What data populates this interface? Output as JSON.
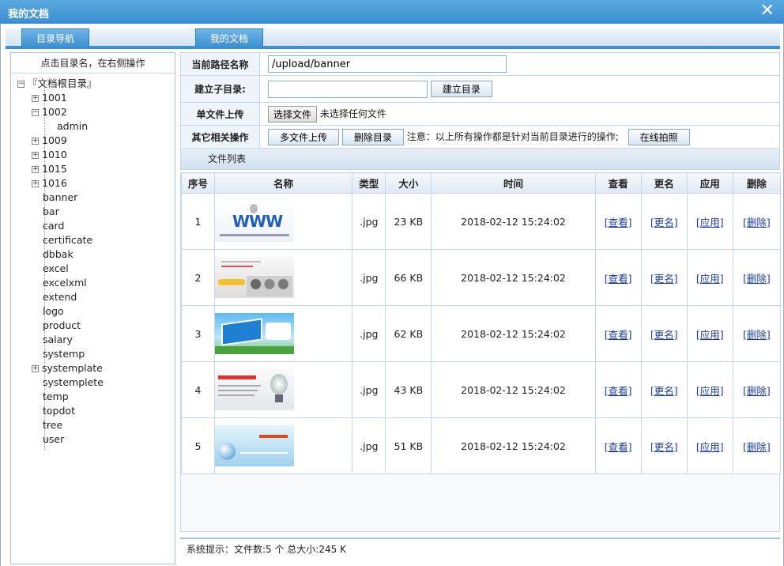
{
  "window": {
    "title": "我的文档",
    "close_glyph": "✕"
  },
  "tabs": [
    {
      "label": "目录导航"
    },
    {
      "label": "我的文档"
    }
  ],
  "left": {
    "hint": "点击目录名，在右侧操作",
    "root": "『文档根目录』",
    "nodes": [
      {
        "label": "1001",
        "expandable": true
      },
      {
        "label": "1002",
        "expanded": true
      },
      {
        "label": "admin",
        "child": true
      },
      {
        "label": "1009",
        "expandable": true
      },
      {
        "label": "1010",
        "expandable": true
      },
      {
        "label": "1015",
        "expandable": true
      },
      {
        "label": "1016",
        "expandable": true
      },
      {
        "label": "banner"
      },
      {
        "label": "bar"
      },
      {
        "label": "card"
      },
      {
        "label": "certificate"
      },
      {
        "label": "dbbak"
      },
      {
        "label": "excel"
      },
      {
        "label": "excelxml"
      },
      {
        "label": "extend"
      },
      {
        "label": "logo"
      },
      {
        "label": "product"
      },
      {
        "label": "salary"
      },
      {
        "label": "systemp"
      },
      {
        "label": "systemplate",
        "expandable": true
      },
      {
        "label": "systemplete"
      },
      {
        "label": "temp"
      },
      {
        "label": "topdot"
      },
      {
        "label": "tree"
      },
      {
        "label": "user"
      }
    ]
  },
  "ops": {
    "path_label": "当前路径名称",
    "path_value": "/upload/banner",
    "mkdir_label": "建立子目录:",
    "mkdir_placeholder": "",
    "mkdir_button": "建立目录",
    "upload_label": "单文件上传",
    "choose_file_button": "选择文件",
    "no_file_text": "未选择任何文件",
    "other_label": "其它相关操作",
    "multi_upload_button": "多文件上传",
    "delete_dir_button": "删除目录",
    "note": "注意：以上所有操作都是针对当前目录进行的操作;",
    "photo_button": "在线拍照"
  },
  "list": {
    "title": "文件列表",
    "headers": [
      "序号",
      "名称",
      "类型",
      "大小",
      "时间",
      "查看",
      "更名",
      "应用",
      "删除"
    ],
    "action_labels": {
      "view": "[查看]",
      "rename": "[更名]",
      "apply": "[应用]",
      "delete": "[删除]"
    },
    "rows": [
      {
        "no": "1",
        "type": ".jpg",
        "size": "23 KB",
        "time": "2018-02-12 15:24:02",
        "thumb": "www-banner"
      },
      {
        "no": "2",
        "type": ".jpg",
        "size": "66 KB",
        "time": "2018-02-12 15:24:02",
        "thumb": "crowd-banner"
      },
      {
        "no": "3",
        "type": ".jpg",
        "size": "62 KB",
        "time": "2018-02-12 15:24:02",
        "thumb": "sky-card-banner"
      },
      {
        "no": "4",
        "type": ".jpg",
        "size": "43 KB",
        "time": "2018-02-12 15:24:02",
        "thumb": "lightbulb-banner"
      },
      {
        "no": "5",
        "type": ".jpg",
        "size": "51 KB",
        "time": "2018-02-12 15:24:02",
        "thumb": "globe-banner"
      }
    ]
  },
  "status": {
    "text": "系统提示：文件数:5 个 总大小:245 K"
  },
  "colors": {
    "accent": "#3d8fd0",
    "link": "#1a3d9f",
    "border": "#c7d6e6"
  }
}
